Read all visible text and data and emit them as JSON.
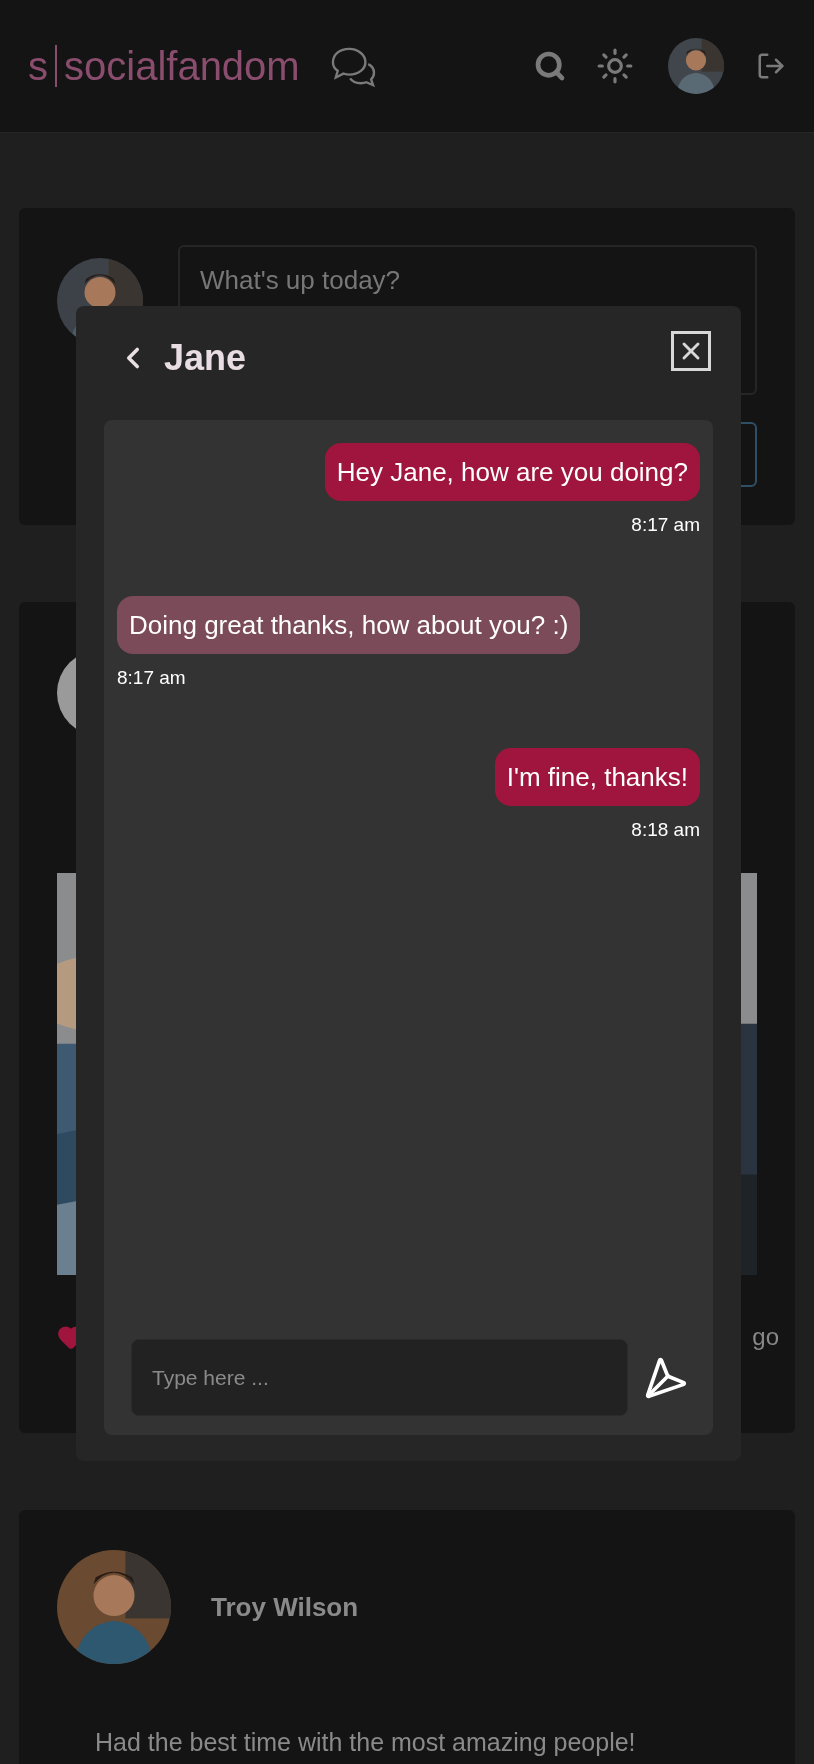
{
  "header": {
    "logo_initial": "s",
    "logo_name": "socialfandom"
  },
  "composer": {
    "placeholder": "What's up today?"
  },
  "post": {
    "meta": "go",
    "liked": true
  },
  "chat": {
    "title": "Jane",
    "messages": [
      {
        "kind": "sent",
        "text": "Hey Jane, how are you doing?",
        "time": "8:17 am"
      },
      {
        "kind": "received",
        "text": "Doing great thanks, how about you? :)",
        "time": "8:17 am"
      },
      {
        "kind": "sent",
        "text": "I'm fine, thanks!",
        "time": "8:18 am"
      }
    ],
    "input": {
      "placeholder": "Type here ..."
    }
  },
  "feed_post": {
    "author": "Troy Wilson",
    "text": "Had the best time with the most amazing people!"
  }
}
